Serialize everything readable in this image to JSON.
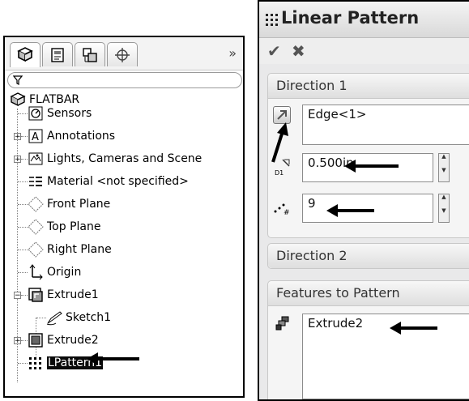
{
  "tree_panel": {
    "tabs": [
      "feature-manager-tab",
      "property-manager-tab",
      "configuration-manager-tab",
      "dim-xpert-manager-tab"
    ],
    "more_label": "»",
    "root": "FLATBAR",
    "items": [
      {
        "label": "Sensors"
      },
      {
        "label": "Annotations",
        "expander": "+"
      },
      {
        "label": "Lights, Cameras and Scene",
        "expander": "+"
      },
      {
        "label": "Material <not specified>"
      },
      {
        "label": "Front Plane"
      },
      {
        "label": "Top Plane"
      },
      {
        "label": "Right Plane"
      },
      {
        "label": "Origin"
      },
      {
        "label": "Extrude1",
        "expander": "−"
      },
      {
        "label": "Sketch1"
      },
      {
        "label": "Extrude2",
        "expander": "+"
      },
      {
        "label": "LPattern1"
      }
    ]
  },
  "pm": {
    "title": "Linear Pattern",
    "ok_label": "✔",
    "cancel_label": "✖",
    "direction1": {
      "header": "Direction 1",
      "edge_value": "Edge<1>",
      "spacing_value": "0.500in",
      "count_value": "9"
    },
    "direction2": {
      "header": "Direction 2"
    },
    "features": {
      "header": "Features to Pattern",
      "item": "Extrude2"
    },
    "collapse_glyph": "⌃"
  },
  "colors": {
    "selection": "#0a0a0a",
    "panel_bg": "#e9e9ea"
  }
}
